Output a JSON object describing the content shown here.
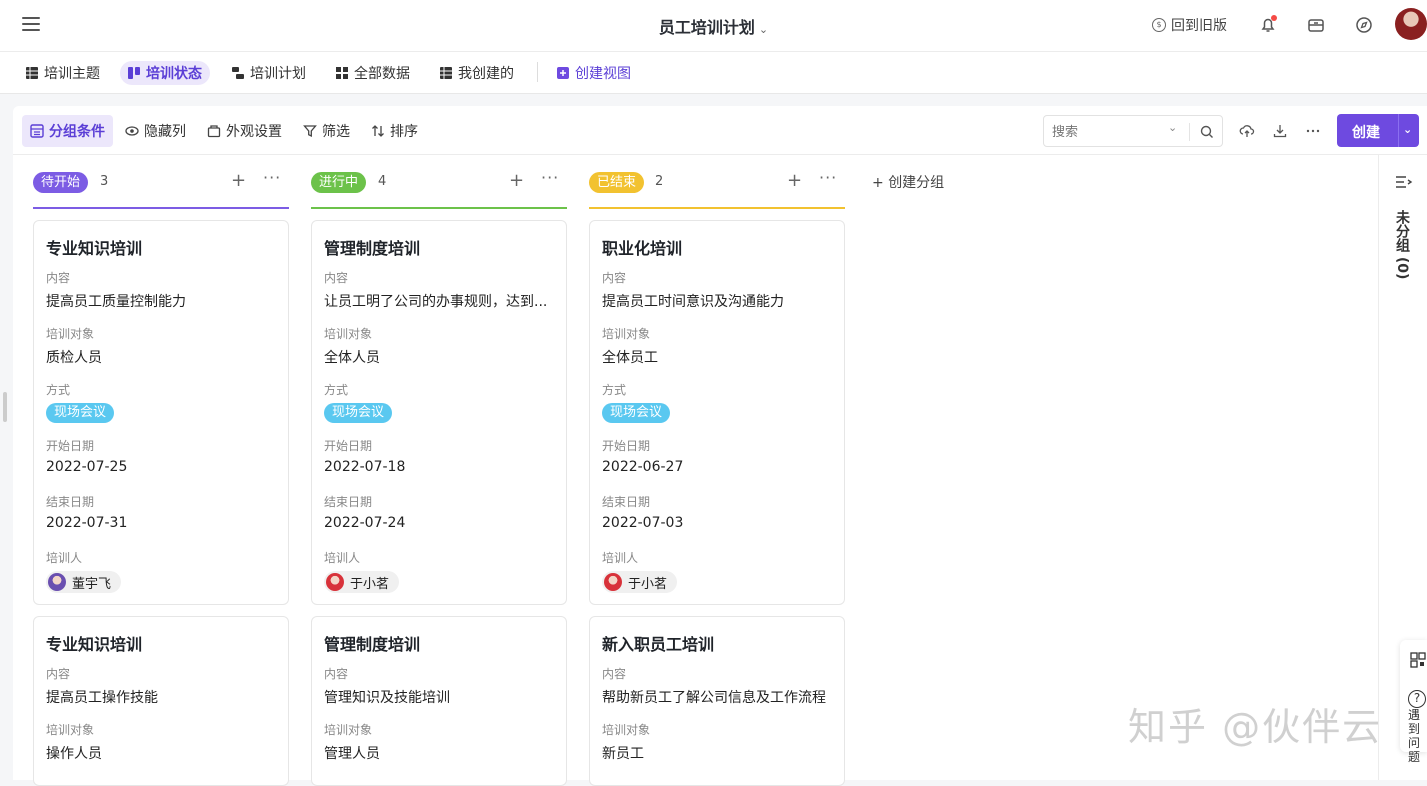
{
  "header": {
    "title": "员工培训计划",
    "back_old": "回到旧版"
  },
  "views": {
    "tabs": [
      "培训主题",
      "培训状态",
      "培训计划",
      "全部数据",
      "我创建的"
    ],
    "create_view": "创建视图"
  },
  "toolbar": {
    "group": "分组条件",
    "hide": "隐藏列",
    "appearance": "外观设置",
    "filter": "筛选",
    "sort": "排序",
    "search_placeholder": "搜索",
    "create": "创建"
  },
  "fields": {
    "content": "内容",
    "target": "培训对象",
    "method": "方式",
    "start": "开始日期",
    "end": "结束日期",
    "trainer": "培训人"
  },
  "columns": [
    {
      "status": "待开始",
      "count": "3",
      "color": "#7c5ce4",
      "cards": [
        {
          "title": "专业知识培训",
          "content": "提高员工质量控制能力",
          "target": "质检人员",
          "method": "现场会议",
          "start": "2022-07-25",
          "end": "2022-07-31",
          "trainer": "董宇飞"
        },
        {
          "title": "专业知识培训",
          "content": "提高员工操作技能",
          "target": "操作人员"
        }
      ]
    },
    {
      "status": "进行中",
      "count": "4",
      "color": "#6cc24a",
      "cards": [
        {
          "title": "管理制度培训",
          "content": "让员工明了公司的办事规则，达到...",
          "target": "全体人员",
          "method": "现场会议",
          "start": "2022-07-18",
          "end": "2022-07-24",
          "trainer": "于小茗"
        },
        {
          "title": "管理制度培训",
          "content": "管理知识及技能培训",
          "target": "管理人员"
        }
      ]
    },
    {
      "status": "已结束",
      "count": "2",
      "color": "#f2c230",
      "cards": [
        {
          "title": "职业化培训",
          "content": "提高员工时间意识及沟通能力",
          "target": "全体员工",
          "method": "现场会议",
          "start": "2022-06-27",
          "end": "2022-07-03",
          "trainer": "于小茗"
        },
        {
          "title": "新入职员工培训",
          "content": "帮助新员工了解公司信息及工作流程",
          "target": "新员工"
        }
      ]
    }
  ],
  "create_group": "创建分组",
  "ungrouped": "未分组 (0)",
  "help": "遇到问题",
  "watermark": "知乎 @伙伴云"
}
